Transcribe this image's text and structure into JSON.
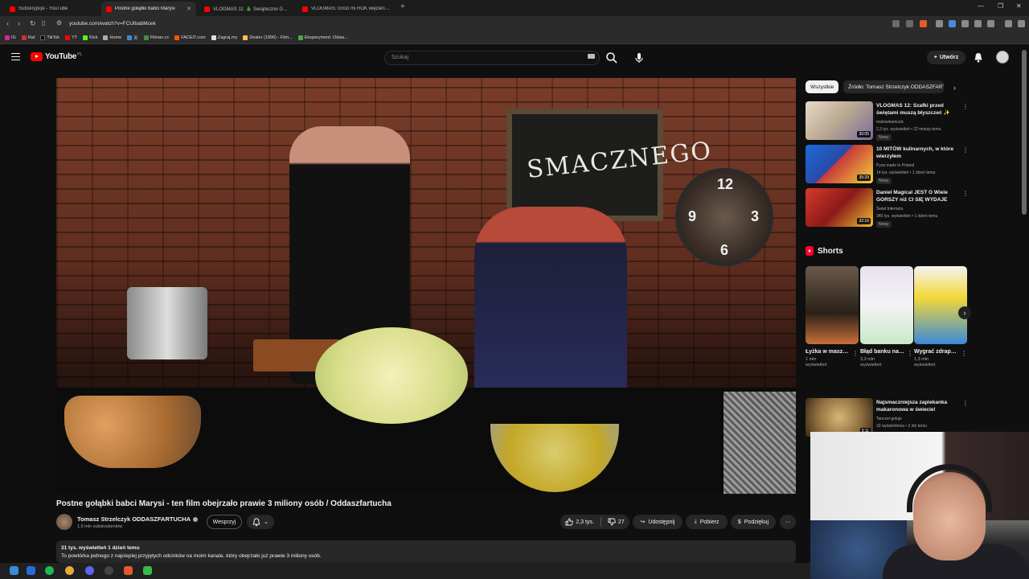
{
  "browser": {
    "tabs": [
      {
        "title": "Subskrypcje - YouTube",
        "active": false
      },
      {
        "title": "Postne gołąbki babci Marysi",
        "active": true
      },
      {
        "title": "VLOGMAS 11: 🎄 Świąteczne Gotowa",
        "active": false
      },
      {
        "title": "VLOGMAS: Grozi mi ROK więzienia -",
        "active": false
      }
    ],
    "url": "youtube.com/watch?v=FCUlbabMcek",
    "bookmarks": [
      "IG",
      "Rat",
      "TikTok",
      "YT",
      "Kick",
      "Home",
      "天",
      "Filman.cc",
      "FACEIT.com",
      "Zagraj.my",
      "Dealer (1996) - Film...",
      "Eksperyment: Odsia..."
    ]
  },
  "youtube": {
    "logo_text": "YouTube",
    "logo_region": "PL",
    "search_placeholder": "Szukaj",
    "create_label": "Utwórz"
  },
  "video": {
    "title": "Postne gołąbki babci Marysi - ten film obejrzało prawie 3 miliony osób / Oddaszfartucha",
    "chalkboard_text": "SMACZNEGO",
    "clock_numbers": [
      "12",
      "9",
      "3",
      "6"
    ],
    "channel_name": "Tomasz Strzelczyk ODDASZFARTUCHA",
    "subscribers": "1,6 mln subskrybentów",
    "support_label": "Wesprzyj",
    "likes": "2,3 tys.",
    "dislikes": "27",
    "share_label": "Udostępnij",
    "download_label": "Pobierz",
    "thanks_label": "Podziękuj",
    "description_meta": "31 tys. wyświetleń  1 dzień temu",
    "description_text": "To powtórka jednego z najcieplej przyjętych odcinków na moim kanale, który obejrzało już prawie 3 miliony osób."
  },
  "sidebar": {
    "chips": [
      "Wszystkie",
      "Źródło: Tomasz Strzelczyk ODDASZFARTUCHA"
    ],
    "recommendations": [
      {
        "title": "VLOGMAS 12: Szafki przed świętami muszą błyszczeć ✨",
        "channel": "makowkamusic",
        "meta": "2,3 tys. wyświetleń • 22 minuty temu",
        "badge": "Nowy",
        "duration": "30:05"
      },
      {
        "title": "10 MITÓW kulinarnych, w które wierzyłem",
        "channel": "Pyza made in Poland",
        "meta": "14 tys. wyświetleń • 1 dzień temu",
        "badge": "Nowy",
        "duration": "35:29"
      },
      {
        "title": "Daniel Magical JEST O Wiele GORSZY niż CI SIĘ WYDAJE",
        "channel": "Świat Internetu",
        "meta": "345 tys. wyświetleń • 1 dzień temu",
        "badge": "Nowy",
        "duration": "32:16"
      }
    ],
    "shorts_title": "Shorts",
    "shorts": [
      {
        "title": "Łyżka w maszynce ...",
        "views": "1 mln wyświetleń"
      },
      {
        "title": "Błąd banku na 2 mln zł",
        "views": "3,3 mln wyświetleń"
      },
      {
        "title": "Wygrać zdrapkę na ...",
        "views": "1,3 mln wyświetleń"
      }
    ],
    "bottom_reco": {
      "title": "Najsmaczniejsza zapiekanka makaronowa w świecie!",
      "channel": "Tanczei gotuje",
      "meta": "32 wyświetlenia • 2 dni temu",
      "duration": "3:11"
    }
  }
}
